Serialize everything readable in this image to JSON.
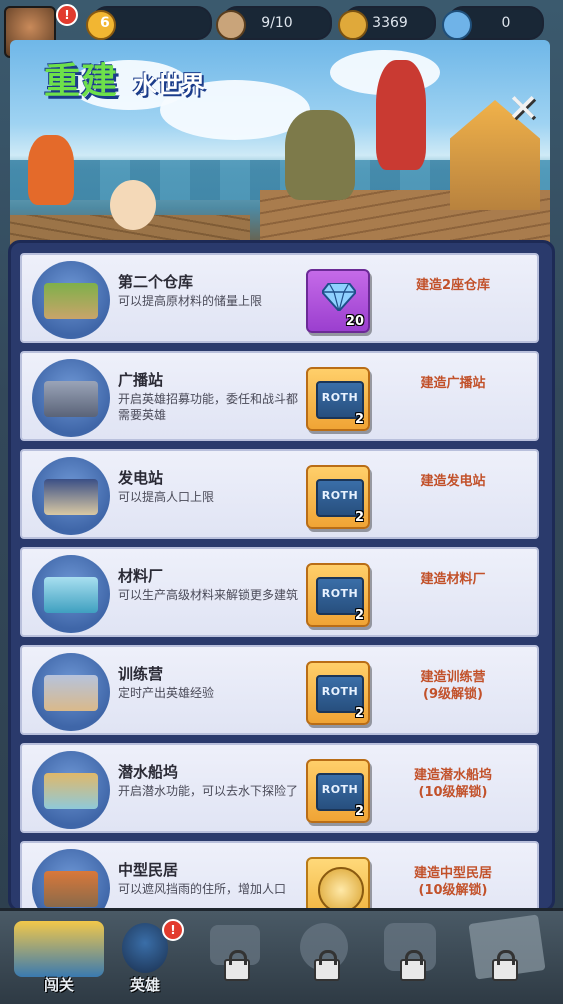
{
  "hud": {
    "level": "6",
    "population": "9/10",
    "coins": "3369",
    "gems": "0"
  },
  "banner": {
    "title_main": "重建",
    "title_sub": "水世界",
    "close_icon": "close-x-icon"
  },
  "buildings": [
    {
      "name": "第二个仓库",
      "desc": "可以提高原材料的储量上限",
      "cost_type": "gem",
      "cost": "20",
      "action": "建造2座仓库",
      "action_sub": "",
      "icon": "warehouse-icon"
    },
    {
      "name": "广播站",
      "desc": "开启英雄招募功能，委任和战斗都需要英雄",
      "cost_type": "card",
      "cost_label": "ROTH",
      "cost": "2",
      "action": "建造广播站",
      "action_sub": "",
      "icon": "radio-station-icon"
    },
    {
      "name": "发电站",
      "desc": "可以提高人口上限",
      "cost_type": "card",
      "cost_label": "ROTH",
      "cost": "2",
      "action": "建造发电站",
      "action_sub": "",
      "icon": "power-station-icon"
    },
    {
      "name": "材料厂",
      "desc": "可以生产高级材料来解锁更多建筑",
      "cost_type": "card",
      "cost_label": "ROTH",
      "cost": "2",
      "action": "建造材料厂",
      "action_sub": "",
      "icon": "material-factory-icon"
    },
    {
      "name": "训练营",
      "desc": "定时产出英雄经验",
      "cost_type": "card",
      "cost_label": "ROTH",
      "cost": "2",
      "action": "建造训练营",
      "action_sub": "(9级解锁)",
      "icon": "training-camp-icon"
    },
    {
      "name": "潜水船坞",
      "desc": "开启潜水功能，可以去水下探险了",
      "cost_type": "card",
      "cost_label": "ROTH",
      "cost": "2",
      "action": "建造潜水船坞",
      "action_sub": "(10级解锁)",
      "icon": "dive-dock-icon"
    },
    {
      "name": "中型民居",
      "desc": "可以遮风挡雨的住所，增加人口",
      "cost_type": "coin",
      "cost": "",
      "action": "建造中型民居",
      "action_sub": "(10级解锁)",
      "icon": "medium-house-icon"
    }
  ],
  "nav": {
    "tabs": [
      {
        "label": "闯关",
        "icon": "ship-bang-icon",
        "locked": false
      },
      {
        "label": "英雄",
        "icon": "hero-icon",
        "locked": false
      },
      {
        "label": "",
        "icon": "backpack-icon",
        "locked": true
      },
      {
        "label": "",
        "icon": "gear-cog-icon",
        "locked": true
      },
      {
        "label": "",
        "icon": "crossed-arms-icon",
        "locked": true
      },
      {
        "label": "",
        "icon": "treasure-map-icon",
        "locked": true
      }
    ]
  },
  "colors": {
    "title_green": "#6ee04a",
    "action_text": "#c2512a",
    "panel": "#2a3a6c",
    "gem_purple": "#9b3fcf",
    "card_orange": "#f0a435"
  }
}
